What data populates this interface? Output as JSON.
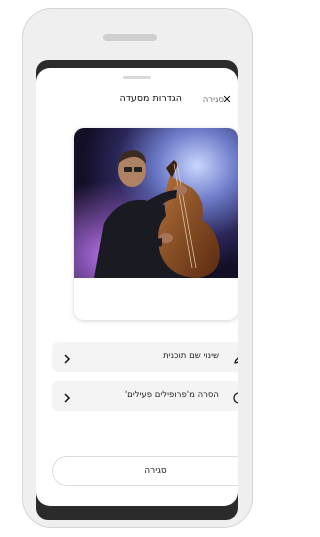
{
  "header": {
    "title": "הגדרות מסעדה",
    "close_label": "סגירה",
    "close_icon": "x-icon"
  },
  "cover": {
    "image_alt": "bass-player-photo"
  },
  "actions": [
    {
      "label": "שינוי שם תוכנית",
      "icon": "pencil-icon"
    },
    {
      "label": "הסרה מ'פרופילים פעילים'",
      "icon": "info-icon"
    }
  ],
  "footer": {
    "button_label": "סגירה"
  },
  "colors": {
    "accent_dark": "#2b2b2b",
    "row_bg": "#f4f4f4"
  }
}
